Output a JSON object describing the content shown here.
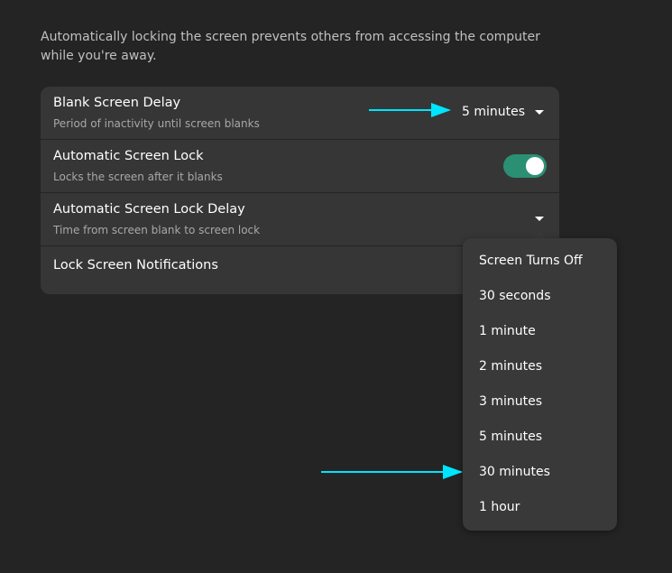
{
  "description": "Automatically locking the screen prevents others from accessing the computer while you're away.",
  "settings": {
    "blank_screen_delay": {
      "title": "Blank Screen Delay",
      "subtitle": "Period of inactivity until screen blanks",
      "value": "5 minutes"
    },
    "automatic_screen_lock": {
      "title": "Automatic Screen Lock",
      "subtitle": "Locks the screen after it blanks",
      "enabled": true
    },
    "automatic_screen_lock_delay": {
      "title": "Automatic Screen Lock Delay",
      "subtitle": "Time from screen blank to screen lock"
    },
    "lock_screen_notifications": {
      "title": "Lock Screen Notifications"
    }
  },
  "lock_delay_menu": {
    "options": [
      "Screen Turns Off",
      "30 seconds",
      "1 minute",
      "2 minutes",
      "3 minutes",
      "5 minutes",
      "30 minutes",
      "1 hour"
    ]
  },
  "colors": {
    "background": "#242424",
    "card": "#363636",
    "accent_toggle": "#2b8f73",
    "annotation_arrow": "#00e5ff"
  },
  "icons": {
    "dropdown": "chevron-down-icon",
    "annotation": "arrow-right-icon"
  }
}
